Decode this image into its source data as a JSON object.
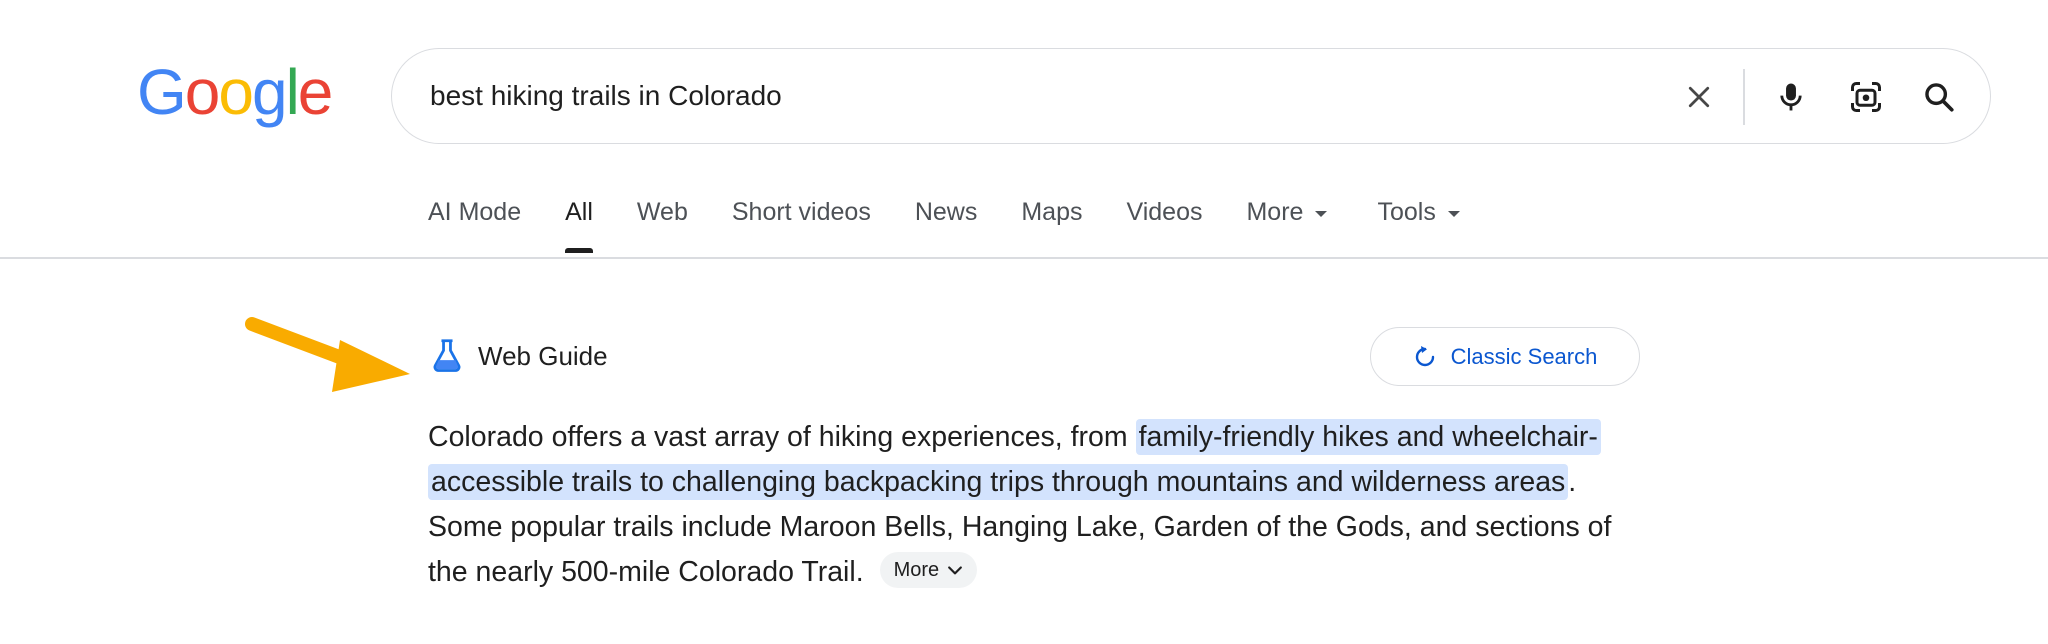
{
  "logo": {
    "letters": [
      "G",
      "o",
      "o",
      "g",
      "l",
      "e"
    ],
    "colors": [
      "#4285f4",
      "#ea4335",
      "#fbbc05",
      "#4285f4",
      "#34a853",
      "#ea4335"
    ]
  },
  "search": {
    "query": "best hiking trails in Colorado"
  },
  "tabs": [
    {
      "label": "AI Mode"
    },
    {
      "label": "All"
    },
    {
      "label": "Web"
    },
    {
      "label": "Short videos"
    },
    {
      "label": "News"
    },
    {
      "label": "Maps"
    },
    {
      "label": "Videos"
    },
    {
      "label": "More"
    },
    {
      "label": "Tools"
    }
  ],
  "web_guide": {
    "label": "Web Guide"
  },
  "classic_search": {
    "label": "Classic Search"
  },
  "summary": {
    "text_before": "Colorado offers a vast array of hiking experiences, from ",
    "highlight": "family-friendly hikes and wheelchair-accessible trails to challenging backpacking trips through mountains and wilderness areas",
    "text_after": ". Some popular trails include Maroon Bells, Hanging Lake, Garden of the Gods, and sections of the nearly 500-mile Colorado Trail.",
    "more_label": "More"
  },
  "colors": {
    "accent_blue": "#0b57d0",
    "highlight": "#d3e3fd",
    "arrow": "#f9ab00"
  },
  "icons": [
    "close-icon",
    "microphone-icon",
    "camera-search-icon",
    "search-icon",
    "flask-icon",
    "refresh-icon",
    "chevron-down-icon",
    "arrow-annotation"
  ]
}
